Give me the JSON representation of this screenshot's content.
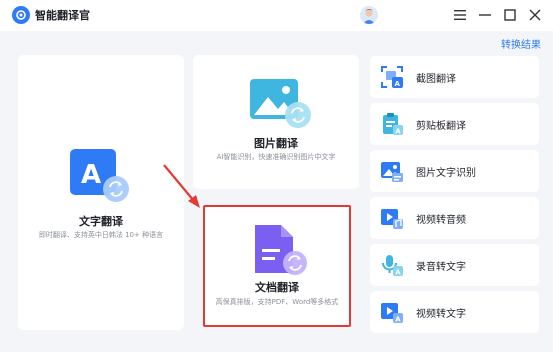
{
  "app": {
    "title": "智能翻译官"
  },
  "header": {
    "result_link": "转换结果"
  },
  "cards": {
    "text_translate": {
      "title": "文字翻译",
      "desc": "即时翻译、支持英中日韩法 10+ 种语言"
    },
    "image_translate": {
      "title": "图片翻译",
      "desc": "AI智能识别，快速准确识别图片中文字"
    },
    "doc_translate": {
      "title": "文档翻译",
      "desc": "高保真排版，支持PDF、Word等多格式"
    }
  },
  "side": {
    "items": [
      {
        "label": "截图翻译",
        "icon": "screenshot-translate-icon"
      },
      {
        "label": "剪贴板翻译",
        "icon": "clipboard-translate-icon"
      },
      {
        "label": "图片文字识别",
        "icon": "image-ocr-icon"
      },
      {
        "label": "视频转音频",
        "icon": "video-to-audio-icon"
      },
      {
        "label": "录音转文字",
        "icon": "recording-to-text-icon"
      },
      {
        "label": "视频转文字",
        "icon": "video-to-text-icon"
      }
    ]
  },
  "colors": {
    "accent": "#2f7bf5",
    "highlight": "#e53935",
    "doc_purple": "#7b5ff0"
  }
}
